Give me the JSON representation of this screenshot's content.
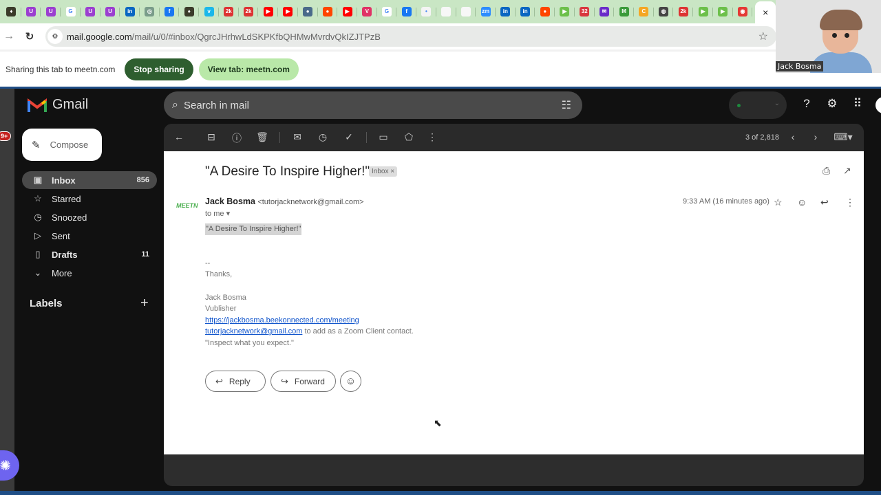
{
  "browser": {
    "tabs": [
      {
        "icon": "crest-icon",
        "color": "#3b3b2a",
        "glyph": "♦"
      },
      {
        "icon": "u-purple-icon",
        "color": "#9b3fd0",
        "glyph": "U"
      },
      {
        "icon": "u-purple-icon",
        "color": "#9b3fd0",
        "glyph": "U"
      },
      {
        "icon": "google-icon",
        "color": "#ffffff",
        "glyph": "G"
      },
      {
        "icon": "u-purple-icon",
        "color": "#9b3fd0",
        "glyph": "U"
      },
      {
        "icon": "u-purple-icon",
        "color": "#9b3fd0",
        "glyph": "U"
      },
      {
        "icon": "linkedin-icon",
        "color": "#0a66c2",
        "glyph": "in"
      },
      {
        "icon": "openai-icon",
        "color": "#7a9c8a",
        "glyph": "◎"
      },
      {
        "icon": "facebook-icon",
        "color": "#1877f2",
        "glyph": "f"
      },
      {
        "icon": "crest-icon",
        "color": "#3b3b2a",
        "glyph": "♦"
      },
      {
        "icon": "vimeo-icon",
        "color": "#1ab7ea",
        "glyph": "v"
      },
      {
        "icon": "2k-icon",
        "color": "#d33",
        "glyph": "2k"
      },
      {
        "icon": "2k-icon",
        "color": "#d33",
        "glyph": "2k"
      },
      {
        "icon": "youtube-icon",
        "color": "#ff0000",
        "glyph": "▶"
      },
      {
        "icon": "youtube-icon",
        "color": "#ff0000",
        "glyph": "▶"
      },
      {
        "icon": "brain-icon",
        "color": "#4a6a8a",
        "glyph": "●"
      },
      {
        "icon": "reddit-icon",
        "color": "#ff4500",
        "glyph": "●"
      },
      {
        "icon": "youtube-icon",
        "color": "#ff0000",
        "glyph": "▶"
      },
      {
        "icon": "vivaldi-icon",
        "color": "#e03366",
        "glyph": "V"
      },
      {
        "icon": "google-icon",
        "color": "#ffffff",
        "glyph": "G"
      },
      {
        "icon": "facebook-icon",
        "color": "#1877f2",
        "glyph": "f"
      },
      {
        "icon": "dot-icon",
        "color": "#f4f4f4",
        "glyph": "•"
      },
      {
        "icon": "blank-page-icon",
        "color": "#f7f7f7",
        "glyph": ""
      },
      {
        "icon": "blank-page-icon",
        "color": "#f7f7f7",
        "glyph": ""
      },
      {
        "icon": "zoom-icon",
        "color": "#2d8cff",
        "glyph": "zm"
      },
      {
        "icon": "linkedin-icon",
        "color": "#0a66c2",
        "glyph": "in"
      },
      {
        "icon": "linkedin-icon",
        "color": "#0a66c2",
        "glyph": "in"
      },
      {
        "icon": "reddit-icon",
        "color": "#ff4500",
        "glyph": "●"
      },
      {
        "icon": "play-green-icon",
        "color": "#6cc04a",
        "glyph": "▶"
      },
      {
        "icon": "calendar-32-icon",
        "color": "#d9363e",
        "glyph": "32"
      },
      {
        "icon": "mail-purple-icon",
        "color": "#6a2bc9",
        "glyph": "✉"
      },
      {
        "icon": "m-green-icon",
        "color": "#3a9a3a",
        "glyph": "M"
      },
      {
        "icon": "c-orange-icon",
        "color": "#f5a623",
        "glyph": "C"
      },
      {
        "icon": "globe-icon",
        "color": "#444",
        "glyph": "◍"
      },
      {
        "icon": "2k-icon",
        "color": "#d33",
        "glyph": "2k"
      },
      {
        "icon": "play-green-icon",
        "color": "#6cc04a",
        "glyph": "▶"
      },
      {
        "icon": "play-green-icon",
        "color": "#6cc04a",
        "glyph": "▶"
      },
      {
        "icon": "record-icon",
        "color": "#e53935",
        "glyph": "◉"
      }
    ],
    "active_tab_close": "×",
    "url_host": "mail.google.com",
    "url_path": "/mail/u/0/#inbox/QgrcJHrhwLdSKPKfbQHMwMvrdvQkIZJTPzB"
  },
  "share_bar": {
    "message": "Sharing this tab to meetn.com",
    "stop_label": "Stop sharing",
    "view_label": "View tab: meetn.com"
  },
  "video_tile": {
    "name": "Jack Bosma"
  },
  "gmail": {
    "app_name": "Gmail",
    "notification_badge": "9+",
    "compose_label": "Compose",
    "search_placeholder": "Search in mail",
    "nav": [
      {
        "label": "Inbox",
        "count": "856",
        "icon": "inbox-icon",
        "glyph": "▣"
      },
      {
        "label": "Starred",
        "count": "",
        "icon": "star-icon",
        "glyph": "☆"
      },
      {
        "label": "Snoozed",
        "count": "",
        "icon": "clock-icon",
        "glyph": "◷"
      },
      {
        "label": "Sent",
        "count": "",
        "icon": "send-icon",
        "glyph": "▷"
      },
      {
        "label": "Drafts",
        "count": "11",
        "icon": "draft-icon",
        "glyph": "▯"
      },
      {
        "label": "More",
        "count": "",
        "icon": "chevron-down-icon",
        "glyph": "⌄"
      }
    ],
    "labels_heading": "Labels",
    "pagination": "3 of 2,818",
    "message": {
      "subject": "\"A Desire To Inspire Higher!\"",
      "label_chip": "Inbox",
      "sender_logo": "MEETN",
      "sender_name": "Jack Bosma",
      "sender_email": "<tutorjacknetwork@gmail.com>",
      "recipient": "to me",
      "time": "9:33 AM (16 minutes ago)",
      "body_highlight": "\"A Desire To Inspire Higher!\"",
      "sig_dash": "--",
      "thanks": "Thanks,",
      "sig_name": "Jack Bosma",
      "sig_title": "Vublisher",
      "sig_link": "https://jackbosma.beekonnected.com/meeting",
      "sig_email_link": "tutorjacknetwork@gmail.com",
      "sig_email_suffix": " to add as a Zoom Client contact.",
      "sig_quote": "\"Inspect what you expect.\""
    },
    "reply_label": "Reply",
    "forward_label": "Forward"
  }
}
